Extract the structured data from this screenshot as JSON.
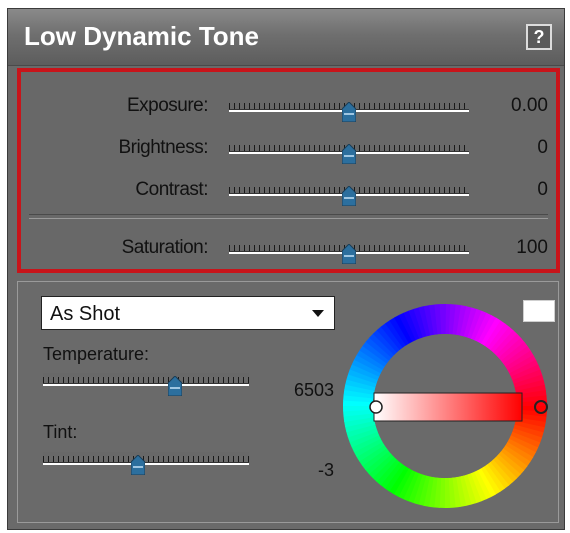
{
  "panel": {
    "title": "Low Dynamic Tone",
    "help_label": "?"
  },
  "tone": {
    "exposure": {
      "label": "Exposure:",
      "value": "0.00",
      "level": 0.5
    },
    "brightness": {
      "label": "Brightness:",
      "value": "0",
      "level": 0.5
    },
    "contrast": {
      "label": "Contrast:",
      "value": "0",
      "level": 0.5
    },
    "saturation": {
      "label": "Saturation:",
      "value": "100",
      "level": 0.5
    }
  },
  "color": {
    "white_balance": {
      "selected": "As Shot",
      "options": [
        "As Shot"
      ]
    },
    "temperature": {
      "label": "Temperature:",
      "value": "6503",
      "level": 0.64
    },
    "tint": {
      "label": "Tint:",
      "value": "-3",
      "level": 0.46
    },
    "swatch_color": "#ffffff",
    "gradient_end_color": "#ff0000"
  },
  "colors": {
    "highlight_border": "#c8141a",
    "thumb": "#2c6f9e"
  },
  "icons": [
    "help-icon",
    "dropdown-arrow-icon",
    "slider-thumb-icon",
    "color-wheel-icon"
  ]
}
